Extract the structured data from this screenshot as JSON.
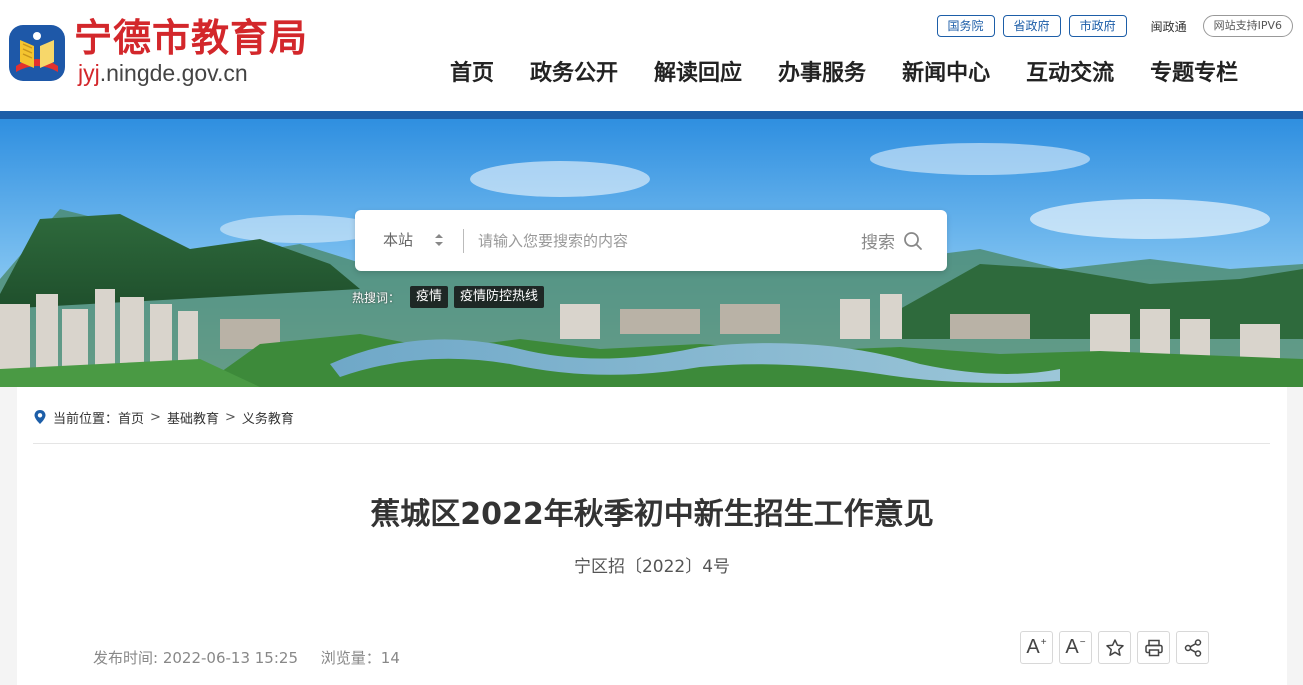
{
  "site": {
    "title": "宁德市教育局",
    "domain_prefix": "jyj",
    "domain_rest": ".ningde.gov.cn"
  },
  "top_links": [
    {
      "label": "国务院"
    },
    {
      "label": "省政府"
    },
    {
      "label": "市政府"
    }
  ],
  "top_plain": "闽政通",
  "ipv6": "网站支持IPV6",
  "nav": [
    {
      "label": "首页"
    },
    {
      "label": "政务公开"
    },
    {
      "label": "解读回应"
    },
    {
      "label": "办事服务"
    },
    {
      "label": "新闻中心"
    },
    {
      "label": "互动交流"
    },
    {
      "label": "专题专栏"
    }
  ],
  "search": {
    "scope": "本站",
    "placeholder": "请输入您要搜索的内容",
    "button": "搜索"
  },
  "hot": {
    "label": "热搜词：",
    "tags": [
      "疫情",
      "疫情防控热线"
    ]
  },
  "breadcrumb": {
    "prefix": "当前位置：",
    "items": [
      "首页",
      "基础教育",
      "义务教育"
    ],
    "separator": ">"
  },
  "article": {
    "title": "蕉城区2022年秋季初中新生招生工作意见",
    "doc_number": "宁区招〔2022〕4号",
    "publish_label": "发布时间: 2022-06-13 15:25",
    "views_label": "浏览量：14"
  },
  "tools": {
    "font_large": "A",
    "font_large_mark": "+",
    "font_small": "A",
    "font_small_mark": "−"
  },
  "colors": {
    "brand_red": "#d3272b",
    "brand_blue": "#1d5ea8"
  }
}
